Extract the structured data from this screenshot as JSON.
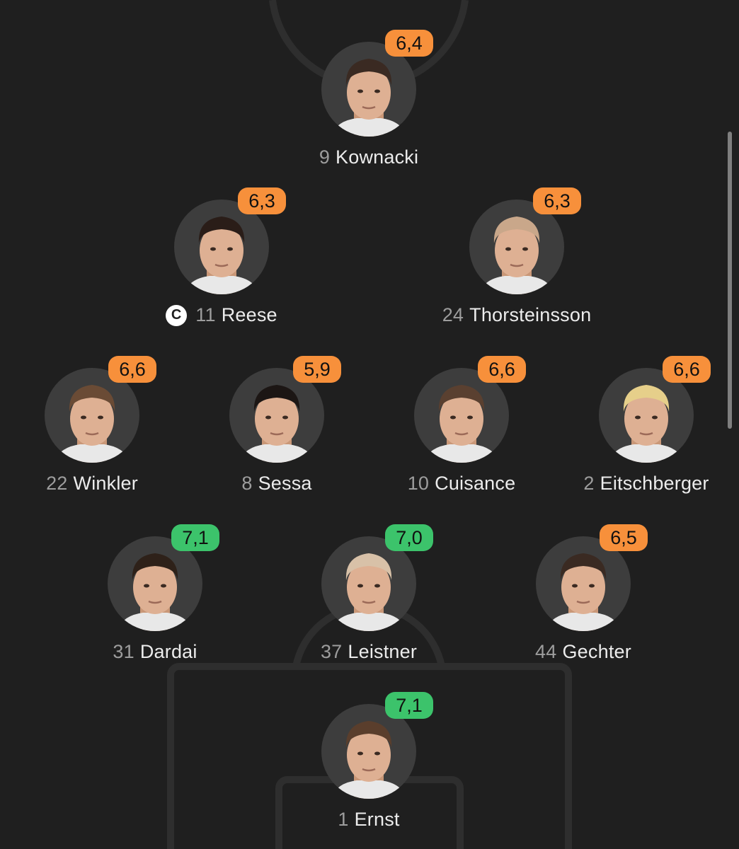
{
  "colors": {
    "rating_orange": "#f7903b",
    "rating_green": "#3cc36b",
    "background": "#1f1f1f",
    "avatar_bg": "#3d3d3d"
  },
  "lineup": {
    "captain_symbol": "C",
    "players": [
      {
        "number": "9",
        "name": "Kownacki",
        "rating": "6,4",
        "status": "orange",
        "captain": false
      },
      {
        "number": "11",
        "name": "Reese",
        "rating": "6,3",
        "status": "orange",
        "captain": true
      },
      {
        "number": "24",
        "name": "Thorsteinsson",
        "rating": "6,3",
        "status": "orange",
        "captain": false
      },
      {
        "number": "22",
        "name": "Winkler",
        "rating": "6,6",
        "status": "orange",
        "captain": false
      },
      {
        "number": "8",
        "name": "Sessa",
        "rating": "5,9",
        "status": "orange",
        "captain": false
      },
      {
        "number": "10",
        "name": "Cuisance",
        "rating": "6,6",
        "status": "orange",
        "captain": false
      },
      {
        "number": "2",
        "name": "Eitschberger",
        "rating": "6,6",
        "status": "orange",
        "captain": false
      },
      {
        "number": "31",
        "name": "Dardai",
        "rating": "7,1",
        "status": "green",
        "captain": false
      },
      {
        "number": "37",
        "name": "Leistner",
        "rating": "7,0",
        "status": "green",
        "captain": false
      },
      {
        "number": "44",
        "name": "Gechter",
        "rating": "6,5",
        "status": "orange",
        "captain": false
      },
      {
        "number": "1",
        "name": "Ernst",
        "rating": "7,1",
        "status": "green",
        "captain": false
      }
    ]
  }
}
